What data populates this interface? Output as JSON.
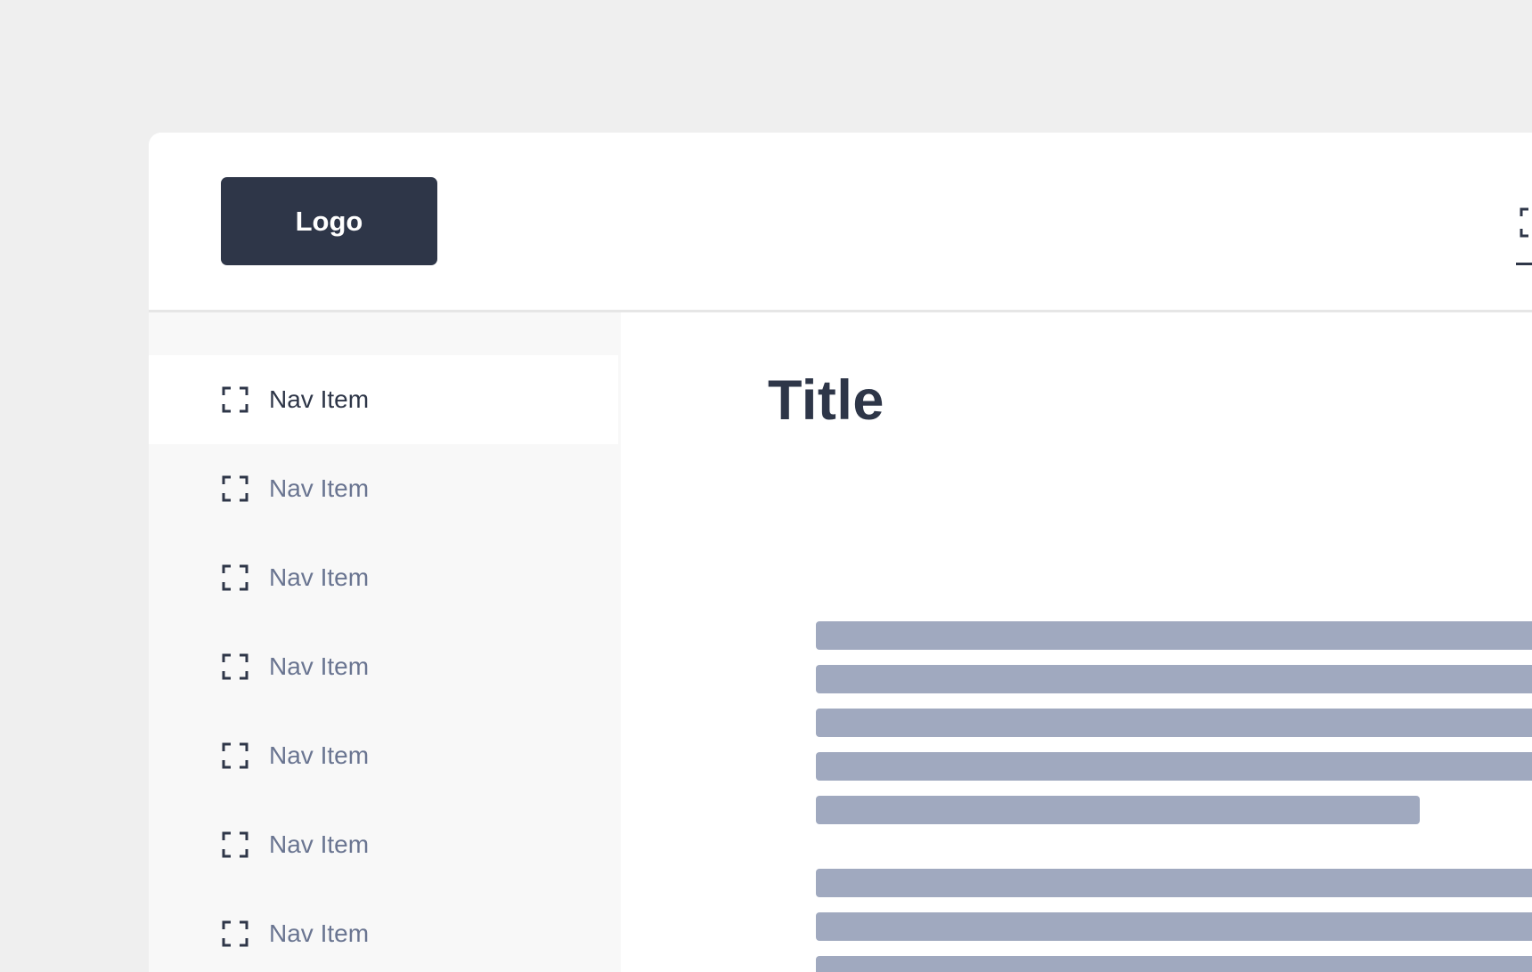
{
  "header": {
    "logo_label": "Logo"
  },
  "sidebar": {
    "items": [
      {
        "label": "Nav Item",
        "icon": "focus-frame-icon",
        "active": true
      },
      {
        "label": "Nav Item",
        "icon": "focus-frame-icon",
        "active": false
      },
      {
        "label": "Nav Item",
        "icon": "focus-frame-icon",
        "active": false
      },
      {
        "label": "Nav Item",
        "icon": "focus-frame-icon",
        "active": false
      },
      {
        "label": "Nav Item",
        "icon": "focus-frame-icon",
        "active": false
      },
      {
        "label": "Nav Item",
        "icon": "focus-frame-icon",
        "active": false
      },
      {
        "label": "Nav Item",
        "icon": "focus-frame-icon",
        "active": false
      }
    ]
  },
  "main": {
    "title": "Title"
  },
  "colors": {
    "background": "#efefef",
    "dark": "#2e3648",
    "muted_text": "#6a7591",
    "placeholder_bar": "#a0a9bf",
    "sidebar_bg": "#f8f8f8"
  }
}
